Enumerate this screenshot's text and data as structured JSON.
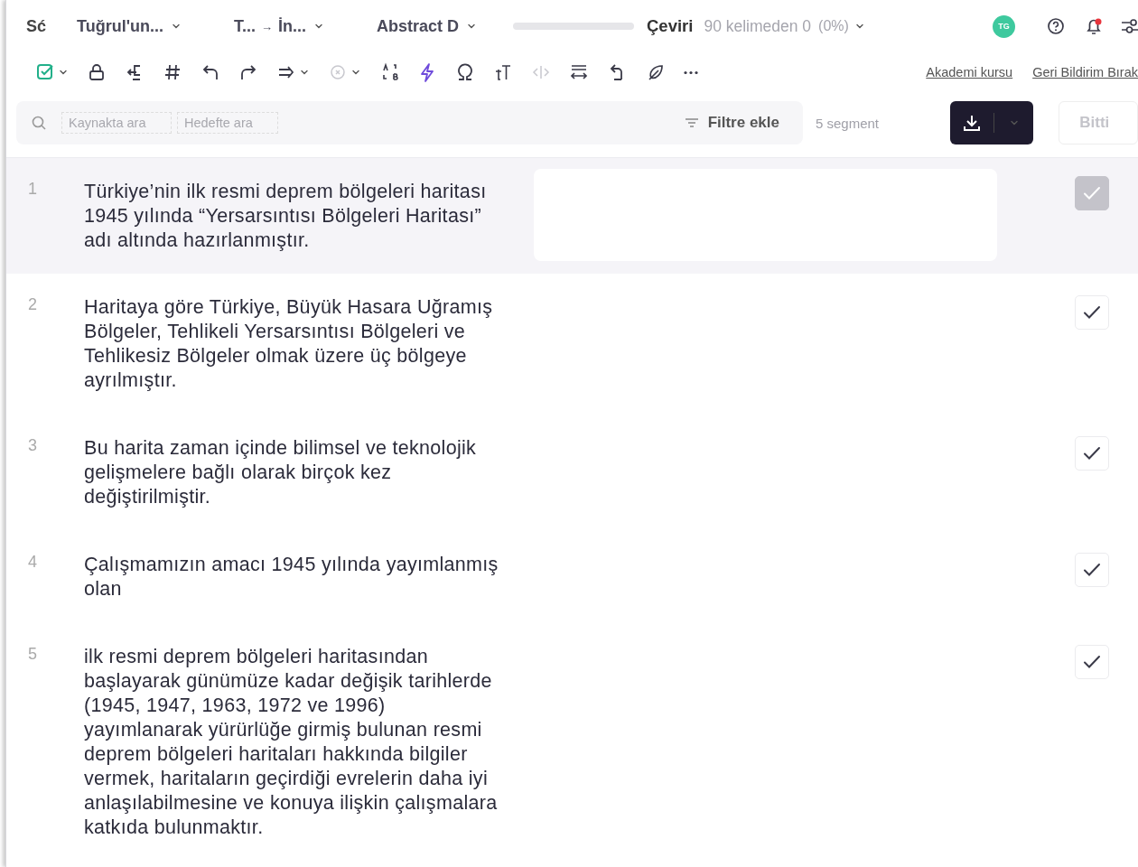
{
  "header": {
    "logo": "Sć",
    "project": "Tuğrul'un...",
    "languages": {
      "source": "T...",
      "arrow": "→",
      "target": "İn..."
    },
    "document": "Abstract D",
    "progress": {
      "level": 0
    },
    "step": "Çeviri",
    "word_count": "90 kelimeden 0",
    "percent": "(0%)",
    "avatar": "TG",
    "notification": true
  },
  "toolbar": [
    {
      "dropdown": true,
      "disabled": false
    },
    {
      "dropdown": false,
      "disabled": false
    },
    {
      "dropdown": false,
      "disabled": false
    },
    {
      "dropdown": false,
      "disabled": false
    },
    {
      "dropdown": false,
      "disabled": false
    },
    {
      "dropdown": false,
      "disabled": false
    },
    {
      "dropdown": true,
      "disabled": false
    },
    {
      "dropdown": true,
      "disabled": true
    },
    {
      "dropdown": false,
      "disabled": false
    },
    {
      "dropdown": false,
      "disabled": false
    },
    {
      "dropdown": false,
      "disabled": false
    },
    {
      "dropdown": false,
      "disabled": false
    },
    {
      "dropdown": false,
      "disabled": true
    },
    {
      "dropdown": false,
      "disabled": false
    },
    {
      "dropdown": false,
      "disabled": false
    },
    {
      "dropdown": false,
      "disabled": false
    },
    {
      "dropdown": false,
      "disabled": false
    }
  ],
  "links": [
    "Akademi kursu",
    "Geri Bildirim Bırak"
  ],
  "search": {
    "source_placeholder": "Kaynakta ara",
    "target_placeholder": "Hedefte ara",
    "filter": "Filtre ekle"
  },
  "segment_count": "5 segment",
  "done_button": "Bitti",
  "segments": [
    {
      "number": "1",
      "source": "Türkiye’nin ilk resmi deprem bölgeleri haritası 1945 yılında “Yersarsıntısı Bölgeleri Haritası” adı altında hazırlanmıştır.",
      "selected": true
    },
    {
      "number": "2",
      "source": "Haritaya göre Türkiye, Büyük Hasara Uğramış Bölgeler, Tehlikeli Yersarsıntısı Bölgeleri ve Tehlikesiz Bölgeler olmak üzere üç bölgeye ayrılmıştır.",
      "selected": false
    },
    {
      "number": "3",
      "source": "Bu harita zaman içinde bilimsel ve teknolojik gelişmelere bağlı olarak birçok kez değiştirilmiştir.",
      "selected": false
    },
    {
      "number": "4",
      "source": "Çalışmamızın amacı 1945 yılında yayımlanmış olan",
      "selected": false
    },
    {
      "number": "5",
      "source": "ilk resmi deprem bölgeleri haritasından başlayarak günümüze kadar değişik tarihlerde (1945, 1947, 1963, 1972 ve 1996) yayımlanarak yürürlüğe girmiş bulunan resmi deprem bölgeleri haritaları hakkında bilgiler vermek, haritaların geçirdiği evrelerin daha iyi anlaşılabilmesine ve konuya ilişkin çalışmalara katkıda bulunmaktır.",
      "selected": false
    }
  ]
}
